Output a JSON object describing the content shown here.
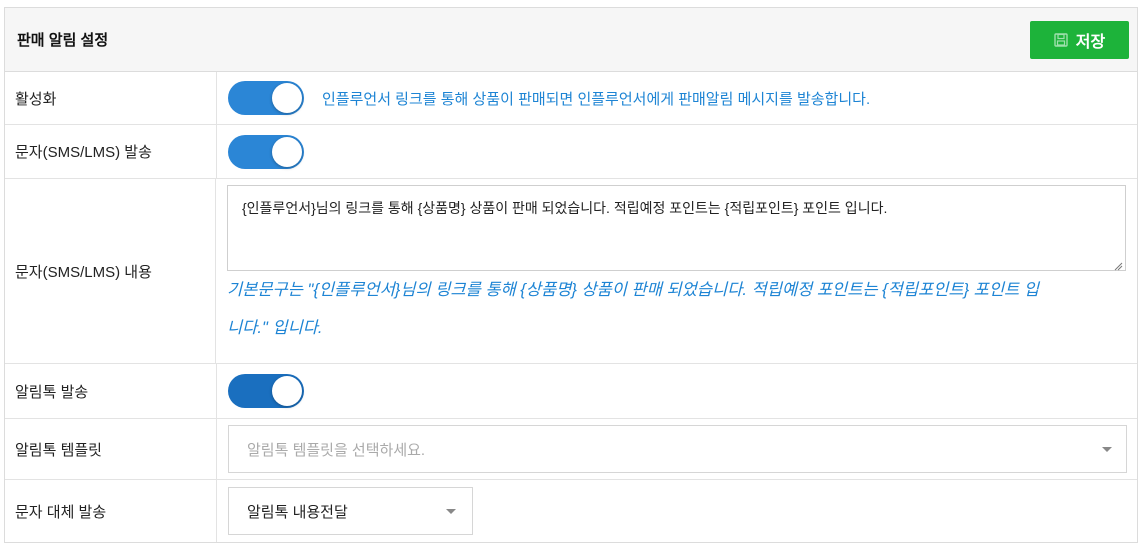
{
  "header": {
    "title": "판매 알림 설정",
    "save_label": "저장",
    "save_icon": "floppy-disk-icon",
    "save_color": "#1db33a"
  },
  "rows": {
    "activation": {
      "label": "활성화",
      "toggle_on": true,
      "hint": "인플루언서 링크를 통해 상품이 판매되면 인플루언서에게 판매알림 메시지를 발송합니다."
    },
    "sms_send": {
      "label": "문자(SMS/LMS) 발송",
      "toggle_on": true
    },
    "sms_content": {
      "label": "문자(SMS/LMS) 내용",
      "value": "{인플루언서}님의 링크를 통해 {상품명} 상품이 판매 되었습니다. 적립예정 포인트는 {적립포인트} 포인트 입니다.",
      "default_hint_line1": "기본문구는 \"{인플루언서}님의 링크를 통해 {상품명} 상품이 판매 되었습니다. 적립예정 포인트는 {적립포인트} 포인트 입",
      "default_hint_line2": "니다.\" 입니다."
    },
    "alimtalk_send": {
      "label": "알림톡 발송",
      "toggle_on": true
    },
    "alimtalk_template": {
      "label": "알림톡 템플릿",
      "placeholder": "알림톡 템플릿을 선택하세요."
    },
    "fallback_send": {
      "label": "문자 대체 발송",
      "selected": "알림톡 내용전달"
    }
  },
  "colors": {
    "toggle_on": "#2b86d6",
    "hint_blue": "#1d84d4"
  }
}
